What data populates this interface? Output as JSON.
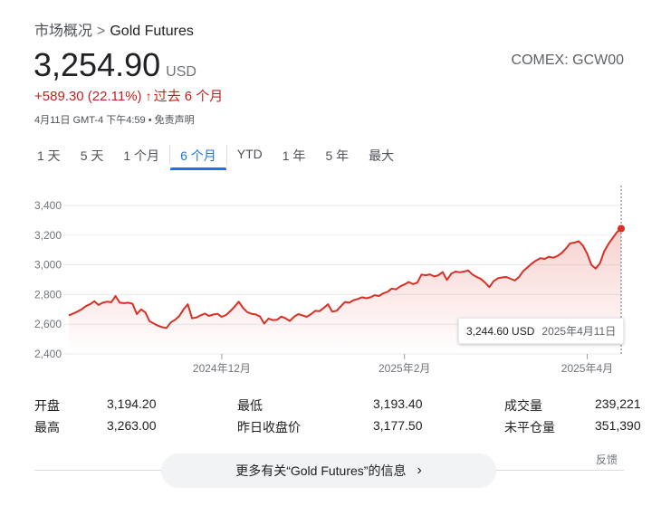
{
  "breadcrumb": {
    "root": "市场概况",
    "sep": ">",
    "current": "Gold Futures"
  },
  "quote": {
    "price": "3,254.90",
    "currency": "USD",
    "exchange": "COMEX: GCW00",
    "change": "+589.30 (22.11%)",
    "change_arrow": "↑",
    "change_period": "过去 6 个月",
    "timestamp": "4月11日 GMT-4 下午4:59 • 免责声明"
  },
  "tabs": [
    {
      "label": "1 天",
      "active": false
    },
    {
      "label": "5 天",
      "active": false
    },
    {
      "label": "1 个月",
      "active": false
    },
    {
      "label": "6 个月",
      "active": true
    },
    {
      "label": "YTD",
      "active": false
    },
    {
      "label": "1 年",
      "active": false
    },
    {
      "label": "5 年",
      "active": false
    },
    {
      "label": "最大",
      "active": false
    }
  ],
  "colors": {
    "line": "#d93025",
    "accent": "#1a73e8",
    "grid": "#e8eaed"
  },
  "chart_data": {
    "type": "area",
    "y_ticks": [
      2400,
      2600,
      2800,
      3000,
      3200,
      3400
    ],
    "y_tick_labels": [
      "2,400",
      "2,600",
      "2,800",
      "3,000",
      "3,200",
      "3,400"
    ],
    "ylim": [
      2400,
      3400
    ],
    "x_ticks": [
      {
        "label": "2024年12月",
        "index": 36
      },
      {
        "label": "2025年2月",
        "index": 79
      },
      {
        "label": "2025年4月",
        "index": 122
      }
    ],
    "grid": true,
    "values": [
      2660,
      2672,
      2685,
      2700,
      2722,
      2735,
      2755,
      2730,
      2745,
      2752,
      2748,
      2790,
      2745,
      2742,
      2745,
      2738,
      2668,
      2700,
      2680,
      2620,
      2605,
      2590,
      2580,
      2575,
      2612,
      2630,
      2655,
      2700,
      2735,
      2640,
      2645,
      2660,
      2672,
      2656,
      2665,
      2670,
      2650,
      2662,
      2688,
      2718,
      2752,
      2710,
      2682,
      2670,
      2666,
      2652,
      2604,
      2638,
      2628,
      2630,
      2652,
      2640,
      2622,
      2650,
      2668,
      2660,
      2650,
      2668,
      2690,
      2688,
      2710,
      2735,
      2685,
      2690,
      2720,
      2750,
      2745,
      2762,
      2770,
      2782,
      2775,
      2782,
      2796,
      2790,
      2808,
      2818,
      2840,
      2835,
      2855,
      2868,
      2885,
      2870,
      2880,
      2935,
      2930,
      2936,
      2922,
      2930,
      2952,
      2898,
      2940,
      2955,
      2950,
      2955,
      2962,
      2935,
      2918,
      2905,
      2880,
      2850,
      2890,
      2910,
      2915,
      2918,
      2906,
      2895,
      2920,
      2960,
      2985,
      3010,
      3030,
      3045,
      3040,
      3055,
      3048,
      3060,
      3080,
      3110,
      3145,
      3150,
      3160,
      3130,
      3075,
      3000,
      2975,
      3010,
      3090,
      3140,
      3180,
      3220,
      3244.6
    ]
  },
  "tooltip": {
    "price": "3,244.60 USD",
    "date": "2025年4月11日"
  },
  "stats": [
    [
      {
        "label": "开盘",
        "value": "3,194.20"
      },
      {
        "label": "最低",
        "value": "3,193.40"
      },
      {
        "label": "成交量",
        "value": "239,221"
      }
    ],
    [
      {
        "label": "最高",
        "value": "3,263.00"
      },
      {
        "label": "昨日收盘价",
        "value": "3,177.50"
      },
      {
        "label": "未平仓量",
        "value": "351,390"
      }
    ]
  ],
  "footer": {
    "feedback": "反馈",
    "more_text": "更多有关“Gold Futures”的信息",
    "more_chev": "›"
  }
}
